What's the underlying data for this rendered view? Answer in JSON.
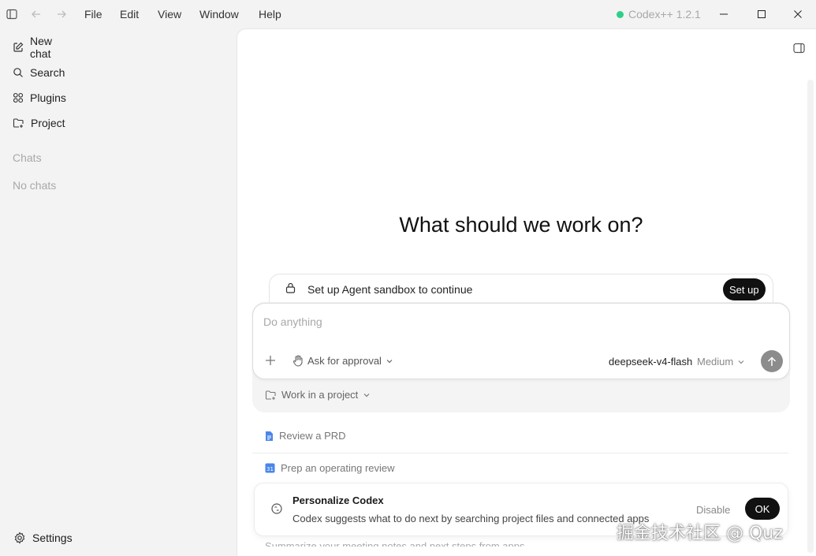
{
  "titlebar": {
    "menus": [
      "File",
      "Edit",
      "View",
      "Window",
      "Help"
    ],
    "app_status": "Codex++ 1.2.1",
    "status_color": "#2fcf88"
  },
  "sidebar": {
    "items": [
      {
        "label": "New chat",
        "icon": "edit-icon"
      },
      {
        "label": "Search",
        "icon": "search-icon"
      },
      {
        "label": "Plugins",
        "icon": "grid-icon"
      },
      {
        "label": "Project",
        "icon": "folder-add-icon"
      }
    ],
    "chats_heading": "Chats",
    "empty_text": "No chats",
    "settings_label": "Settings"
  },
  "main": {
    "heading": "What should we work on?",
    "sandbox": {
      "text": "Set up Agent sandbox to continue",
      "button": "Set up"
    },
    "composer": {
      "placeholder": "Do anything",
      "approval": "Ask for approval",
      "model": "deepseek-v4-flash",
      "effort": "Medium"
    },
    "project_picker": "Work in a project",
    "suggestions": [
      {
        "label": "Review a PRD",
        "icon": "doc-icon"
      },
      {
        "label": "Prep an operating review",
        "icon": "calendar-icon"
      }
    ],
    "toast": {
      "title": "Personalize Codex",
      "description": "Codex suggests what to do next by searching project files and connected apps",
      "disable": "Disable",
      "ok": "OK"
    }
  },
  "watermark": "掘金技术社区 @ Quz"
}
